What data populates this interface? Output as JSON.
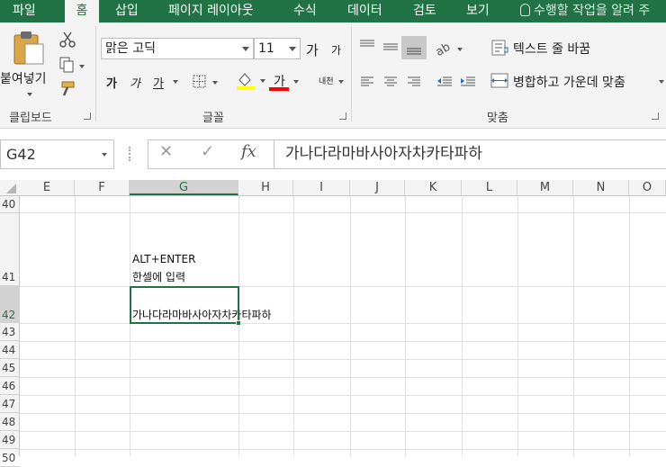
{
  "menu": {
    "items": [
      "파일",
      "홈",
      "삽입",
      "페이지 레이아웃",
      "수식",
      "데이터",
      "검토",
      "보기"
    ],
    "active": "홈",
    "tell_me": "수행할 작업을 알려 주"
  },
  "ribbon": {
    "clipboard": {
      "paste_label": "붙여넣기",
      "group_label": "클립보드"
    },
    "font": {
      "font_name": "맑은 고딕",
      "font_size": "11",
      "grow_label": "가",
      "shrink_label": "가",
      "bold_label": "가",
      "italic_label": "가",
      "underline_label": "가",
      "font_color_label": "가",
      "phonetic_label": "내천",
      "group_label": "글꼴"
    },
    "alignment": {
      "wrap_text": "텍스트 줄 바꿈",
      "merge_center": "병합하고 가운데 맞춤",
      "group_label": "맞춤"
    }
  },
  "formula_bar": {
    "name_box": "G42",
    "cancel_icon": "✕",
    "enter_icon": "✓",
    "fx_label": "fx",
    "content": "가나다라마바사아자차카타파하"
  },
  "sheet": {
    "columns": [
      "E",
      "F",
      "G",
      "H",
      "I",
      "J",
      "K",
      "L",
      "M",
      "N",
      "O"
    ],
    "selected_column": "G",
    "rows": [
      "40",
      "41",
      "42",
      "43",
      "44",
      "45",
      "46",
      "47",
      "48",
      "49",
      "50"
    ],
    "selected_row": "42",
    "cells": {
      "g41_line1": "ALT+ENTER",
      "g41_line2": "한셀에 입력",
      "g42": "가나다라마바사아자차카타파하"
    }
  },
  "colors": {
    "accent": "#217346",
    "ribbon_bg": "#f3f3f3",
    "font_color_bar": "#ff0000",
    "fill_color_bar": "#ffff00"
  }
}
